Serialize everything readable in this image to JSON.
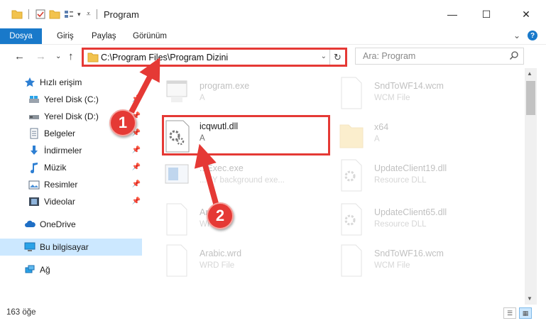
{
  "window": {
    "title": "Program",
    "minimize": "—",
    "maximize": "☐",
    "close": "✕"
  },
  "ribbon": {
    "tabs": [
      "Dosya",
      "Giriş",
      "Paylaş",
      "Görünüm"
    ],
    "expand": "⌄",
    "help": "?"
  },
  "nav": {
    "back": "←",
    "forward": "→",
    "recent": "⌄",
    "up": "↑"
  },
  "address": {
    "path": "C:\\Program Files\\Program Dizini",
    "dropdown": "⌄",
    "refresh": "↻"
  },
  "search": {
    "placeholder": "Ara: Program"
  },
  "sidebar": {
    "items": [
      {
        "label": "Hızlı erişim",
        "icon": "star-icon"
      },
      {
        "label": "Yerel Disk (C:)",
        "icon": "drive-icon"
      },
      {
        "label": "Yerel Disk (D:)",
        "icon": "drive-icon"
      },
      {
        "label": "Belgeler",
        "icon": "document-icon"
      },
      {
        "label": "İndirmeler",
        "icon": "download-icon"
      },
      {
        "label": "Müzik",
        "icon": "music-icon"
      },
      {
        "label": "Resimler",
        "icon": "pictures-icon"
      },
      {
        "label": "Videolar",
        "icon": "video-icon"
      },
      {
        "label": "OneDrive",
        "icon": "cloud-icon"
      },
      {
        "label": "Bu bilgisayar",
        "icon": "computer-icon"
      },
      {
        "label": "Ağ",
        "icon": "network-icon"
      }
    ],
    "pin": "📌"
  },
  "files": {
    "left": [
      {
        "name": "program.exe",
        "desc": "A"
      },
      {
        "name": "icqwutl.dll",
        "desc": "A"
      },
      {
        "name": "...Exec.exe",
        "desc": "...NY background exe..."
      },
      {
        "name": "Ar...ord",
        "desc": "WR..."
      },
      {
        "name": "Arabic.wrd",
        "desc": "WRD File"
      }
    ],
    "right": [
      {
        "name": "SndToWF14.wcm",
        "desc": "WCM File"
      },
      {
        "name": "x64",
        "desc": "A"
      },
      {
        "name": "UpdateClient19.dll",
        "desc": "Resource DLL"
      },
      {
        "name": "UpdateClient65.dll",
        "desc": "Resource DLL"
      },
      {
        "name": "SndToWF16.wcm",
        "desc": "WCM File"
      }
    ]
  },
  "status": {
    "count": "163 öğe"
  },
  "annotations": {
    "step1": "1",
    "step2": "2"
  },
  "colors": {
    "accent": "#1979ca",
    "highlight": "#e53935",
    "selected": "#cce8ff"
  }
}
